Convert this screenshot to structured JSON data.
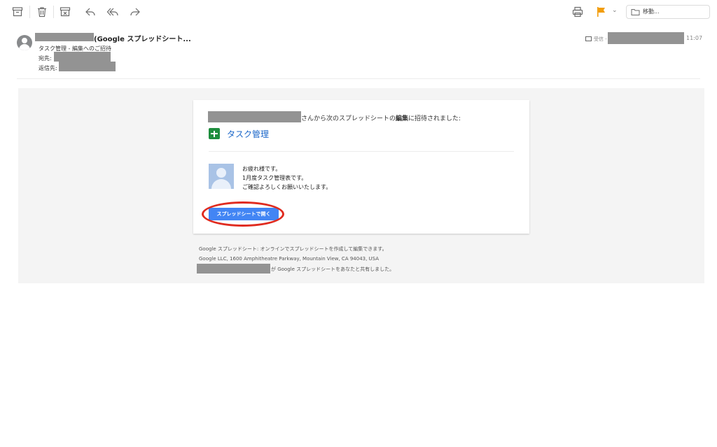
{
  "toolbar": {
    "icons": [
      "archive-icon",
      "trash-icon",
      "junk-icon",
      "reply-icon",
      "reply-all-icon",
      "forward-icon",
      "print-icon",
      "flag-icon",
      "chevron-down-icon",
      "folder-icon"
    ],
    "move_label": "移動...",
    "flag_color": "#f29d0b"
  },
  "header": {
    "subject": "(Google スプレッドシート...",
    "subtitle": "タスク管理 - 編集へのご招待",
    "to_label": "宛先:",
    "reply_to_label": "返信先:",
    "inbox_label": "受信 -",
    "time": "11:07"
  },
  "email": {
    "invite_suffix": "さんから次のスプレッドシートの",
    "invite_bold": "編集",
    "invite_end": "に招待されました:",
    "doc_title": "タスク管理",
    "message_lines": [
      "お疲れ様です。",
      "1月度タスク管理表です。",
      "ご確認よろしくお願いいたします。"
    ],
    "open_button": "スプレッドシートで開く",
    "button_color": "#4285f4",
    "highlight_color": "#e02b1f",
    "footer_line1": "Google スプレッドシート: オンラインでスプレッドシートを作成して編集できます。",
    "footer_line2": "Google LLC, 1600 Amphitheatre Parkway, Mountain View, CA 94043, USA",
    "footer_line3": "が Google スプレッドシートをあなたと共有しました。"
  }
}
